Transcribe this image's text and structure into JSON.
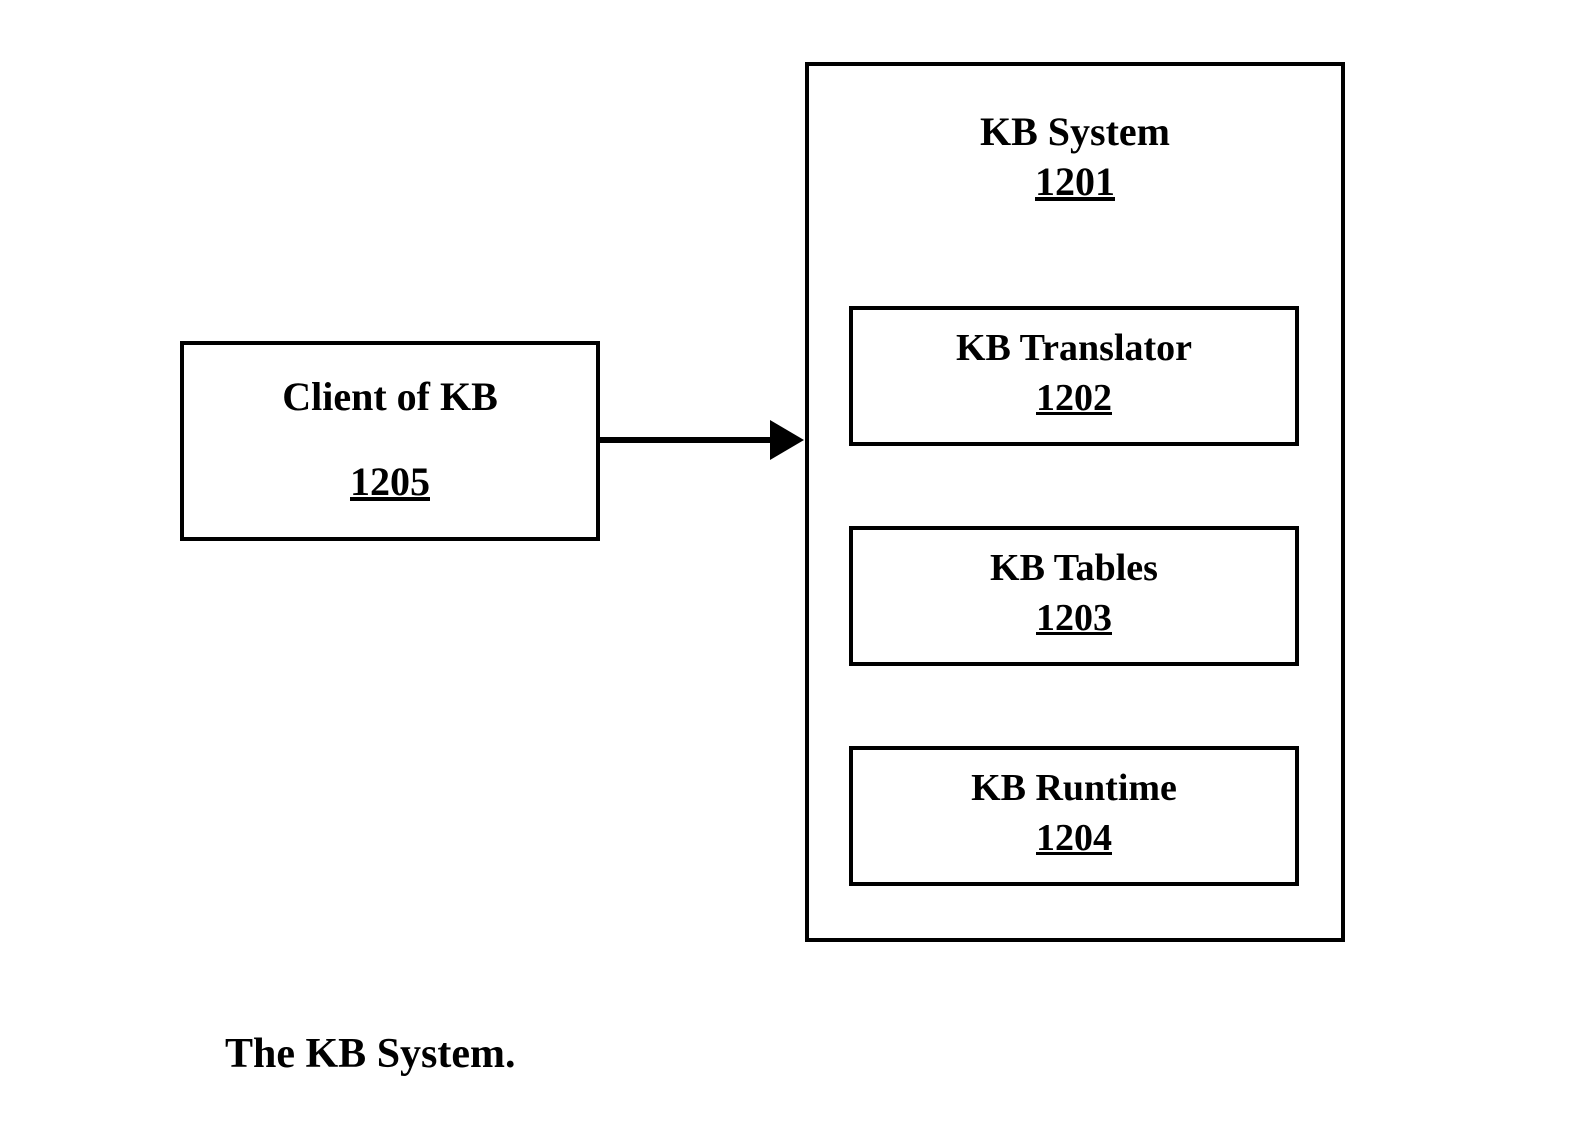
{
  "client": {
    "title": "Client of KB",
    "ref": "1205"
  },
  "system": {
    "title": "KB System",
    "ref": "1201",
    "components": [
      {
        "label": "KB Translator",
        "ref": "1202"
      },
      {
        "label": "KB Tables",
        "ref": "1203"
      },
      {
        "label": "KB Runtime",
        "ref": "1204"
      }
    ]
  },
  "caption": "The KB System."
}
